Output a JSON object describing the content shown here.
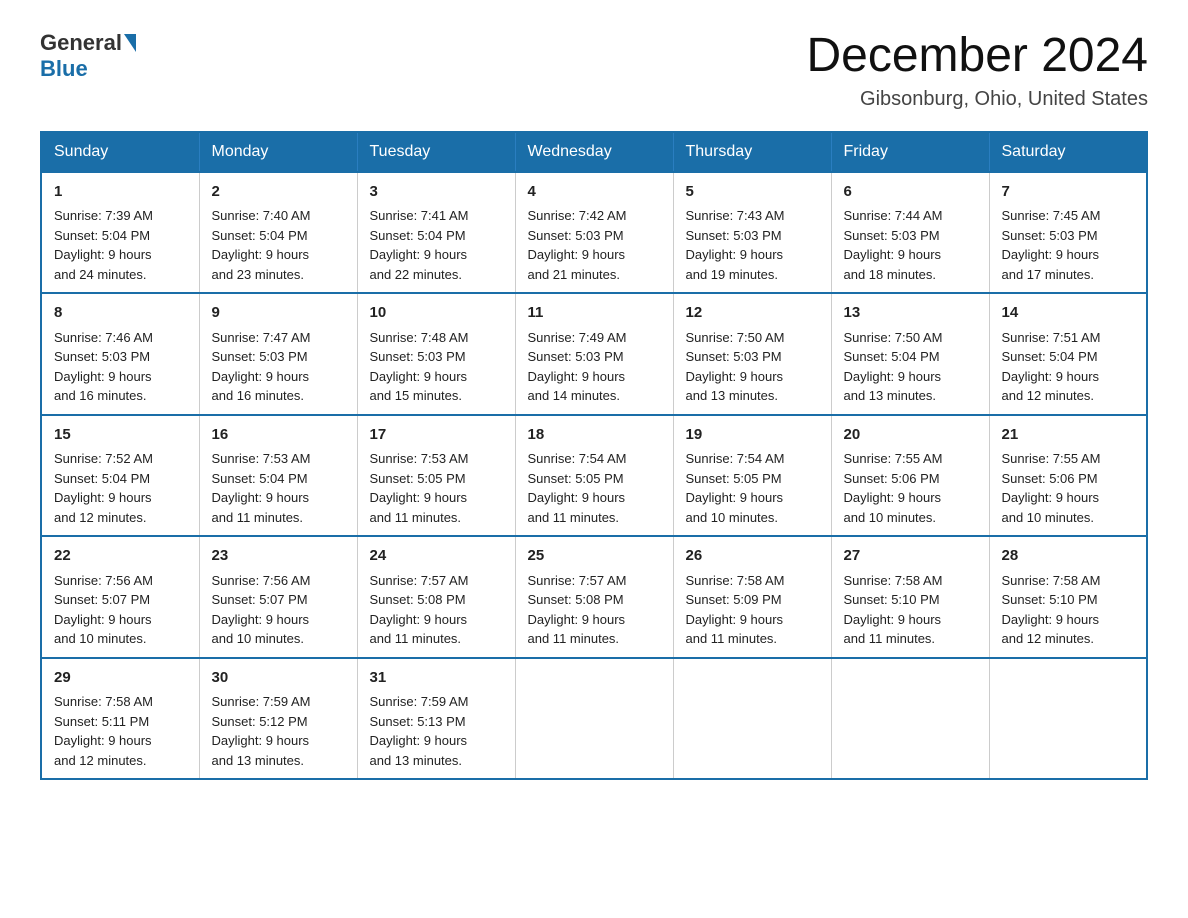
{
  "logo": {
    "general": "General",
    "blue": "Blue"
  },
  "title": "December 2024",
  "subtitle": "Gibsonburg, Ohio, United States",
  "days_of_week": [
    "Sunday",
    "Monday",
    "Tuesday",
    "Wednesday",
    "Thursday",
    "Friday",
    "Saturday"
  ],
  "weeks": [
    [
      {
        "day": "1",
        "sunrise": "7:39 AM",
        "sunset": "5:04 PM",
        "daylight": "9 hours and 24 minutes."
      },
      {
        "day": "2",
        "sunrise": "7:40 AM",
        "sunset": "5:04 PM",
        "daylight": "9 hours and 23 minutes."
      },
      {
        "day": "3",
        "sunrise": "7:41 AM",
        "sunset": "5:04 PM",
        "daylight": "9 hours and 22 minutes."
      },
      {
        "day": "4",
        "sunrise": "7:42 AM",
        "sunset": "5:03 PM",
        "daylight": "9 hours and 21 minutes."
      },
      {
        "day": "5",
        "sunrise": "7:43 AM",
        "sunset": "5:03 PM",
        "daylight": "9 hours and 19 minutes."
      },
      {
        "day": "6",
        "sunrise": "7:44 AM",
        "sunset": "5:03 PM",
        "daylight": "9 hours and 18 minutes."
      },
      {
        "day": "7",
        "sunrise": "7:45 AM",
        "sunset": "5:03 PM",
        "daylight": "9 hours and 17 minutes."
      }
    ],
    [
      {
        "day": "8",
        "sunrise": "7:46 AM",
        "sunset": "5:03 PM",
        "daylight": "9 hours and 16 minutes."
      },
      {
        "day": "9",
        "sunrise": "7:47 AM",
        "sunset": "5:03 PM",
        "daylight": "9 hours and 16 minutes."
      },
      {
        "day": "10",
        "sunrise": "7:48 AM",
        "sunset": "5:03 PM",
        "daylight": "9 hours and 15 minutes."
      },
      {
        "day": "11",
        "sunrise": "7:49 AM",
        "sunset": "5:03 PM",
        "daylight": "9 hours and 14 minutes."
      },
      {
        "day": "12",
        "sunrise": "7:50 AM",
        "sunset": "5:03 PM",
        "daylight": "9 hours and 13 minutes."
      },
      {
        "day": "13",
        "sunrise": "7:50 AM",
        "sunset": "5:04 PM",
        "daylight": "9 hours and 13 minutes."
      },
      {
        "day": "14",
        "sunrise": "7:51 AM",
        "sunset": "5:04 PM",
        "daylight": "9 hours and 12 minutes."
      }
    ],
    [
      {
        "day": "15",
        "sunrise": "7:52 AM",
        "sunset": "5:04 PM",
        "daylight": "9 hours and 12 minutes."
      },
      {
        "day": "16",
        "sunrise": "7:53 AM",
        "sunset": "5:04 PM",
        "daylight": "9 hours and 11 minutes."
      },
      {
        "day": "17",
        "sunrise": "7:53 AM",
        "sunset": "5:05 PM",
        "daylight": "9 hours and 11 minutes."
      },
      {
        "day": "18",
        "sunrise": "7:54 AM",
        "sunset": "5:05 PM",
        "daylight": "9 hours and 11 minutes."
      },
      {
        "day": "19",
        "sunrise": "7:54 AM",
        "sunset": "5:05 PM",
        "daylight": "9 hours and 10 minutes."
      },
      {
        "day": "20",
        "sunrise": "7:55 AM",
        "sunset": "5:06 PM",
        "daylight": "9 hours and 10 minutes."
      },
      {
        "day": "21",
        "sunrise": "7:55 AM",
        "sunset": "5:06 PM",
        "daylight": "9 hours and 10 minutes."
      }
    ],
    [
      {
        "day": "22",
        "sunrise": "7:56 AM",
        "sunset": "5:07 PM",
        "daylight": "9 hours and 10 minutes."
      },
      {
        "day": "23",
        "sunrise": "7:56 AM",
        "sunset": "5:07 PM",
        "daylight": "9 hours and 10 minutes."
      },
      {
        "day": "24",
        "sunrise": "7:57 AM",
        "sunset": "5:08 PM",
        "daylight": "9 hours and 11 minutes."
      },
      {
        "day": "25",
        "sunrise": "7:57 AM",
        "sunset": "5:08 PM",
        "daylight": "9 hours and 11 minutes."
      },
      {
        "day": "26",
        "sunrise": "7:58 AM",
        "sunset": "5:09 PM",
        "daylight": "9 hours and 11 minutes."
      },
      {
        "day": "27",
        "sunrise": "7:58 AM",
        "sunset": "5:10 PM",
        "daylight": "9 hours and 11 minutes."
      },
      {
        "day": "28",
        "sunrise": "7:58 AM",
        "sunset": "5:10 PM",
        "daylight": "9 hours and 12 minutes."
      }
    ],
    [
      {
        "day": "29",
        "sunrise": "7:58 AM",
        "sunset": "5:11 PM",
        "daylight": "9 hours and 12 minutes."
      },
      {
        "day": "30",
        "sunrise": "7:59 AM",
        "sunset": "5:12 PM",
        "daylight": "9 hours and 13 minutes."
      },
      {
        "day": "31",
        "sunrise": "7:59 AM",
        "sunset": "5:13 PM",
        "daylight": "9 hours and 13 minutes."
      },
      null,
      null,
      null,
      null
    ]
  ],
  "labels": {
    "sunrise": "Sunrise:",
    "sunset": "Sunset:",
    "daylight": "Daylight:"
  }
}
